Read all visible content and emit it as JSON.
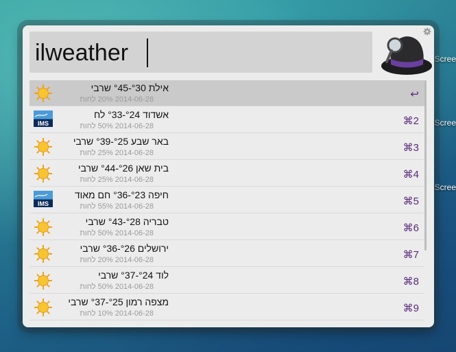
{
  "desktop": {
    "labels": [
      "Scree",
      "Scree",
      "Scree"
    ]
  },
  "search": {
    "query": "ilweather"
  },
  "results": [
    {
      "icon": "sun-icon",
      "title": "אילת °30-°45 שרבי",
      "subtitle": "2014-06-28 20% לחות",
      "shortcut": "↩",
      "selected": true
    },
    {
      "icon": "ims-logo-icon",
      "title": "אשדוד °24-°33 לח",
      "subtitle": "2014-06-28 50% לחות",
      "shortcut": "⌘2",
      "selected": false
    },
    {
      "icon": "sun-icon",
      "title": "באר שבע °25-°39 שרבי",
      "subtitle": "2014-06-28 25% לחות",
      "shortcut": "⌘3",
      "selected": false
    },
    {
      "icon": "sun-icon",
      "title": "בית שאן °26-°44 שרבי",
      "subtitle": "2014-06-28 25% לחות",
      "shortcut": "⌘4",
      "selected": false
    },
    {
      "icon": "ims-logo-icon",
      "title": "חיפה °23-°36 חם מאוד",
      "subtitle": "2014-06-28 55% לחות",
      "shortcut": "⌘5",
      "selected": false
    },
    {
      "icon": "sun-icon",
      "title": "טבריה °28-°43 שרבי",
      "subtitle": "2014-06-28 50% לחות",
      "shortcut": "⌘6",
      "selected": false
    },
    {
      "icon": "sun-icon",
      "title": "ירושלים °26-°36 שרבי",
      "subtitle": "2014-06-28 20% לחות",
      "shortcut": "⌘7",
      "selected": false
    },
    {
      "icon": "sun-icon",
      "title": "לוד °24-°37 שרבי",
      "subtitle": "2014-06-28 50% לחות",
      "shortcut": "⌘8",
      "selected": false
    },
    {
      "icon": "sun-icon",
      "title": "מצפה רמון °25-°37 שרבי",
      "subtitle": "2014-06-28 10% לחות",
      "shortcut": "⌘9",
      "selected": false
    }
  ]
}
